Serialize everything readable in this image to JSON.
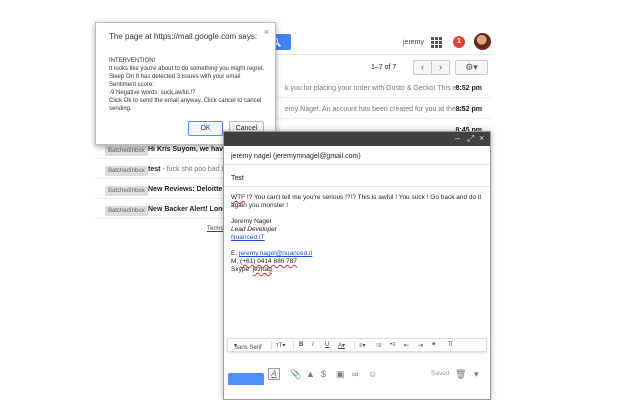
{
  "header": {
    "user_name": "jeremy",
    "notification_count": "1"
  },
  "toolbar": {
    "pager": "1–7 of 7",
    "prev_icon": "chevron-left-icon",
    "next_icon": "chevron-right-icon",
    "settings_icon": "gear-icon"
  },
  "rows": [
    {
      "time": "8:52 pm",
      "preview": "k you for placing your order with Gusto & Gecko! This e:"
    },
    {
      "time": "8:52 pm",
      "preview": "emy Nagel. An account has been created for you at the sh"
    },
    {
      "time": "8:45 pm",
      "preview": ""
    }
  ],
  "list_rows": [
    {
      "label": "BatchedInbox",
      "subject": "Hi Kris Suyom, we have",
      "snippet": ""
    },
    {
      "label": "BatchedInbox",
      "subject": "test",
      "snippet": "- fuck shit poo bad te"
    },
    {
      "label": "BatchedInbox",
      "subject": "New Reviews: Deloitte",
      "snippet": "-"
    },
    {
      "label": "BatchedInbox",
      "subject": "New Backer Alert! Longs",
      "snippet": ""
    }
  ],
  "footer": {
    "terms": "Terms"
  },
  "alert": {
    "title": "The page at https://mail.google.com says:",
    "body_lines": [
      "INTERVENTION!",
      "It looks like you're about to do something you might regret.",
      "Sleep On It has detected 3 issues with your email",
      "Sentiment score:",
      "-9 Negative words: suck,awful,!?",
      "Click Ok to send the email anyway. Click cancel to cancel",
      "sending."
    ],
    "ok_label": "OK",
    "cancel_label": "Cancel"
  },
  "compose": {
    "to": "jeremy nagel (jeremymnagel@gmail.com)",
    "subject": "Test",
    "body_word": "WTF",
    "body_line1_rest": " !? You can't tell me you're serious !?!? This is awful ! You suck ! Go back and do it",
    "body_line2": "again you monster !",
    "sig_name": "Jeremy Nagel",
    "sig_title": "Lead Developer",
    "sig_company": "Nuanced IT",
    "sig_email_label": "E: ",
    "sig_email": "jeremy.nagel@nuanced.it",
    "sig_phone_label": "M: ",
    "sig_phone": "(+61) 0414 886 787",
    "sig_skype_label": "Skype: ",
    "sig_skype": "jeznag",
    "font_label": "Sans Serif",
    "saved_label": "Saved"
  },
  "colors": {
    "accent": "#4285f4",
    "notification": "#db4437",
    "compose_bar": "#404040"
  }
}
